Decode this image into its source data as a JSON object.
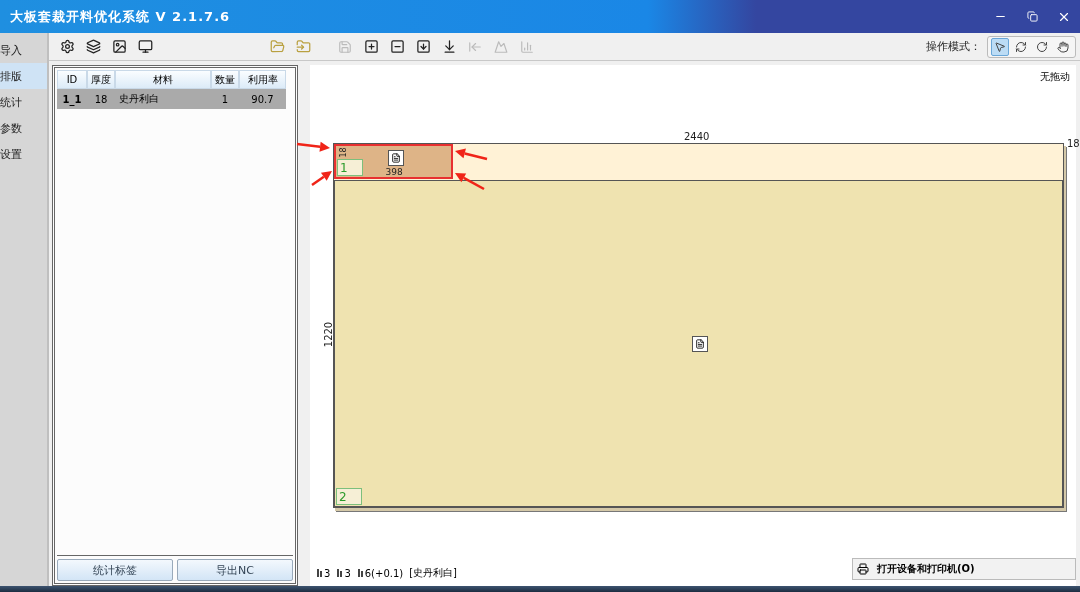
{
  "window": {
    "title": "大板套裁开料优化系统 V 2.1.7.6"
  },
  "nav": [
    {
      "label": "导入",
      "selected": false
    },
    {
      "label": "排版",
      "selected": true
    },
    {
      "label": "统计",
      "selected": false
    },
    {
      "label": "参数",
      "selected": false
    },
    {
      "label": "设置",
      "selected": false
    }
  ],
  "toolbar": {
    "mode_label": "操作模式：",
    "modes": [
      {
        "kind": "pointer",
        "selected": true
      },
      {
        "kind": "refresh",
        "selected": false
      },
      {
        "kind": "rotate",
        "selected": false
      },
      {
        "kind": "hand",
        "selected": false
      }
    ]
  },
  "table": {
    "columns": [
      "ID",
      "厚度",
      "材料",
      "数量",
      "利用率"
    ],
    "rows": [
      {
        "cells": [
          "1_1",
          "18",
          "史丹利白",
          "1",
          "90.7"
        ],
        "selected": true
      }
    ]
  },
  "buttons": [
    "统计标签",
    "导出NC"
  ],
  "canvas": {
    "drag_status": "无拖动",
    "board": {
      "width_label": "2440",
      "height_label": "1220",
      "thickness_label": "18"
    },
    "parts": [
      {
        "number": "1",
        "width_label": "398",
        "height_label": "18",
        "selected": true
      },
      {
        "number": "2",
        "selected": false
      }
    ]
  },
  "status": {
    "items": [
      "3",
      "3",
      "6(+0.1)",
      "[史丹利白]"
    ]
  },
  "tooltip": "打开设备和打印机(O)"
}
